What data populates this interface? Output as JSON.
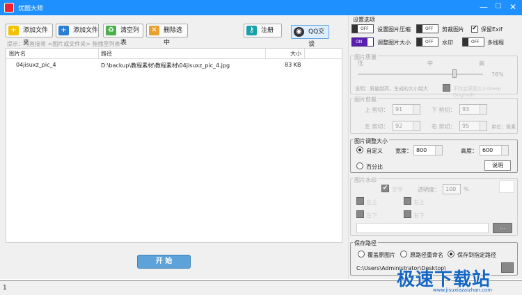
{
  "window": {
    "title": "优图大师",
    "minimize": "—",
    "maximize": "☐",
    "close": "✕"
  },
  "toolbar": {
    "add_folder": "添加文件夹",
    "add_file": "添加文件",
    "clear_list": "清空列表",
    "delete_selected": "删除选中",
    "register": "注册",
    "qq": "QQ交谈"
  },
  "hint": "提示：可直接将 <图片或文件夹> 拖拽至列表",
  "table": {
    "columns": [
      "图片名",
      "路径",
      "大小"
    ],
    "rows": [
      {
        "name": "04jisuxz_pic_4",
        "path": "D:\\backup\\教程素材\\教程素材\\04jisuxz_pic_4.jpg",
        "size": "83 KB"
      }
    ]
  },
  "start_button": "开 始",
  "settings": {
    "title": "设置选项",
    "options": [
      {
        "label": "设置图片压缩",
        "state": "OFF",
        "on": false
      },
      {
        "label": "剪裁图片",
        "state": "OFF",
        "on": false
      },
      {
        "label": "调整图片大小",
        "state": "ON",
        "on": true
      },
      {
        "label": "水印",
        "state": "OFF",
        "on": false
      },
      {
        "label": "多线程",
        "state": "OFF",
        "on": false
      }
    ],
    "keep_exif": "保留Exif"
  },
  "quality": {
    "title": "图片质量",
    "low": "低",
    "mid": "中",
    "high": "高",
    "percent": "76%",
    "note": "说明：质量越高，生成的大小越大",
    "note2": "不改变原图大小(Keep Original)"
  },
  "crop": {
    "title": "图片剪裁",
    "top_label": "上 剪切：",
    "top_value": "91",
    "bottom_label": "下 剪切：",
    "bottom_value": "93",
    "left_label": "左 剪切：",
    "left_value": "92",
    "right_label": "右 剪切：",
    "right_value": "95",
    "unit": "单位：像素"
  },
  "resize": {
    "title": "图片调整大小",
    "custom": "自定义",
    "width_label": "宽度：",
    "width_value": "800",
    "height_label": "高度：",
    "height_value": "600",
    "percent": "百分比",
    "help": "说明"
  },
  "watermark": {
    "title": "图片水印",
    "text": "文字",
    "opacity_label": "透明度：",
    "opacity_value": "100",
    "percent": "%",
    "pos1": "左上",
    "pos2": "右上",
    "pos3": "左下",
    "pos4": "右下",
    "browse": "..."
  },
  "save": {
    "title": "保存路径",
    "overwrite": "覆盖原图片",
    "rename": "原路径重命名",
    "custom_path": "保存到指定路径",
    "path": "C:\\Users\\Administrator\\Desktop\\"
  },
  "status": {
    "text": "1"
  },
  "watermark_site": {
    "main": "极速下载站",
    "url": "www.jisuxiazaizhan.com"
  }
}
